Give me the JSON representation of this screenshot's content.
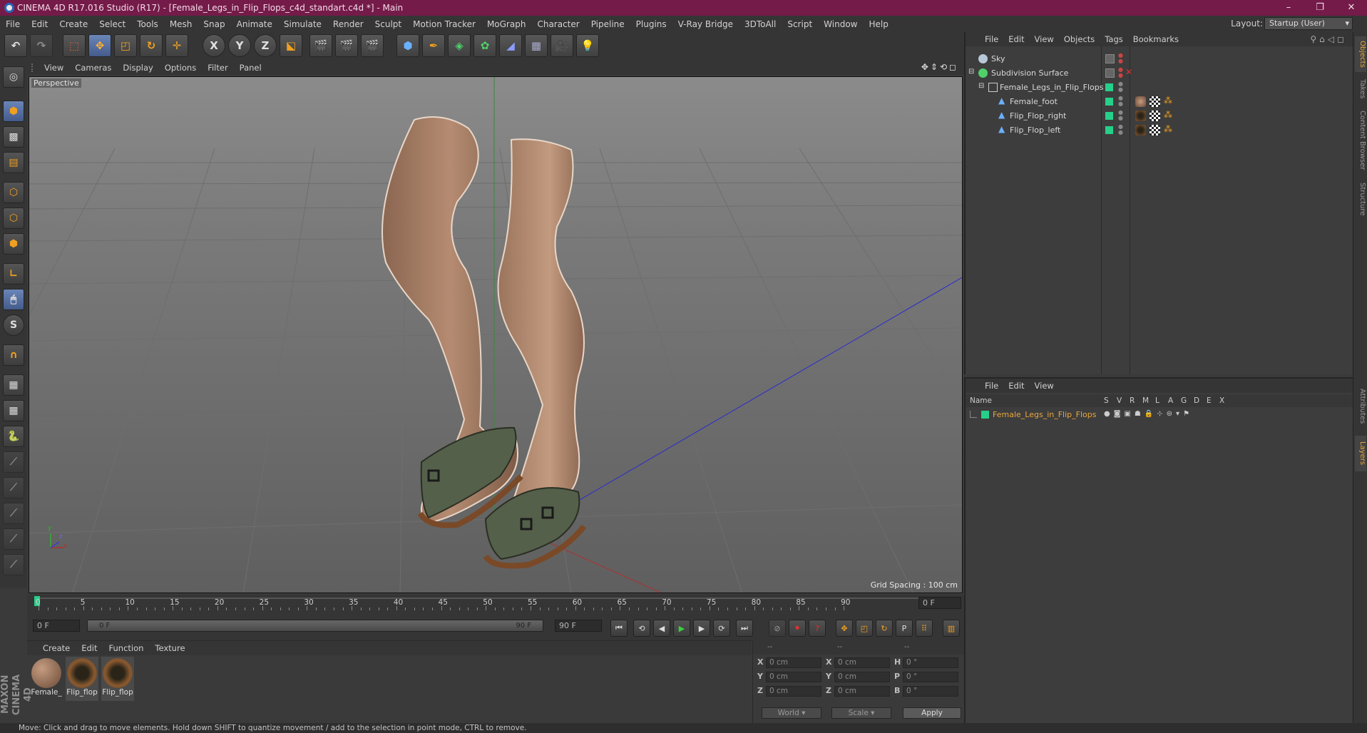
{
  "window": {
    "title": "CINEMA 4D R17.016 Studio (R17) - [Female_Legs_in_Flip_Flops_c4d_standart.c4d *] - Main",
    "controls": [
      "–",
      "❐",
      "✕"
    ]
  },
  "menubar": {
    "items": [
      "File",
      "Edit",
      "Create",
      "Select",
      "Tools",
      "Mesh",
      "Snap",
      "Animate",
      "Simulate",
      "Render",
      "Sculpt",
      "Motion Tracker",
      "MoGraph",
      "Character",
      "Pipeline",
      "Plugins",
      "V-Ray Bridge",
      "3DToAll",
      "Script",
      "Window",
      "Help"
    ],
    "layout_label": "Layout:",
    "layout_value": "Startup (User)"
  },
  "toolbar": {
    "axis_x": "X",
    "axis_y": "Y",
    "axis_z": "Z"
  },
  "viewport": {
    "menu": [
      "View",
      "Cameras",
      "Display",
      "Options",
      "Filter",
      "Panel"
    ],
    "label": "Perspective",
    "grid_spacing": "Grid Spacing : 100 cm",
    "axis_x": "x",
    "axis_y": "y",
    "axis_z": "z"
  },
  "timeline": {
    "ticks": [
      "0",
      "5",
      "10",
      "15",
      "20",
      "25",
      "30",
      "35",
      "40",
      "45",
      "50",
      "55",
      "60",
      "65",
      "70",
      "75",
      "80",
      "85",
      "90"
    ],
    "current_frame": "0 F",
    "start_frame": "0 F",
    "slider_start": "0 F",
    "slider_end": "90 F",
    "end_frame": "90 F"
  },
  "materials": {
    "menu": [
      "Create",
      "Edit",
      "Function",
      "Texture"
    ],
    "items": [
      {
        "label": "Female_"
      },
      {
        "label": "Flip_flop"
      },
      {
        "label": "Flip_flop"
      }
    ]
  },
  "coordinates": {
    "header": [
      "--",
      "--",
      "--"
    ],
    "rows": [
      {
        "a": "X",
        "v1": "0 cm",
        "b": "X",
        "v2": "0 cm",
        "c": "H",
        "v3": "0 °"
      },
      {
        "a": "Y",
        "v1": "0 cm",
        "b": "Y",
        "v2": "0 cm",
        "c": "P",
        "v3": "0 °"
      },
      {
        "a": "Z",
        "v1": "0 cm",
        "b": "Z",
        "v2": "0 cm",
        "c": "B",
        "v3": "0 °"
      }
    ],
    "world": "World",
    "scale": "Scale",
    "apply": "Apply"
  },
  "objects": {
    "menu": [
      "File",
      "Edit",
      "View",
      "Objects",
      "Tags",
      "Bookmarks"
    ],
    "items": [
      {
        "name": "Sky"
      },
      {
        "name": "Subdivision Surface"
      },
      {
        "name": "Female_Legs_in_Flip_Flops"
      },
      {
        "name": "Female_foot"
      },
      {
        "name": "Flip_Flop_right"
      },
      {
        "name": "Flip_Flop_left"
      }
    ]
  },
  "layers": {
    "menu": [
      "File",
      "Edit",
      "View"
    ],
    "columns": [
      "Name",
      "S",
      "V",
      "R",
      "M",
      "L",
      "A",
      "G",
      "D",
      "E",
      "X"
    ],
    "items": [
      {
        "name": "Female_Legs_in_Flip_Flops"
      }
    ]
  },
  "side_tabs": [
    "Objects",
    "Takes",
    "Content Browser",
    "Structure",
    "Attributes",
    "Layers"
  ],
  "status": "Move: Click and drag to move elements. Hold down SHIFT to quantize movement / add to the selection in point mode, CTRL to remove.",
  "logo": "MAXON CINEMA 4D",
  "colors": {
    "titlebar": "#751b4a",
    "accent": "#6a85b8",
    "layer_name": "#e8a63c",
    "visibility": "#27d08a"
  }
}
